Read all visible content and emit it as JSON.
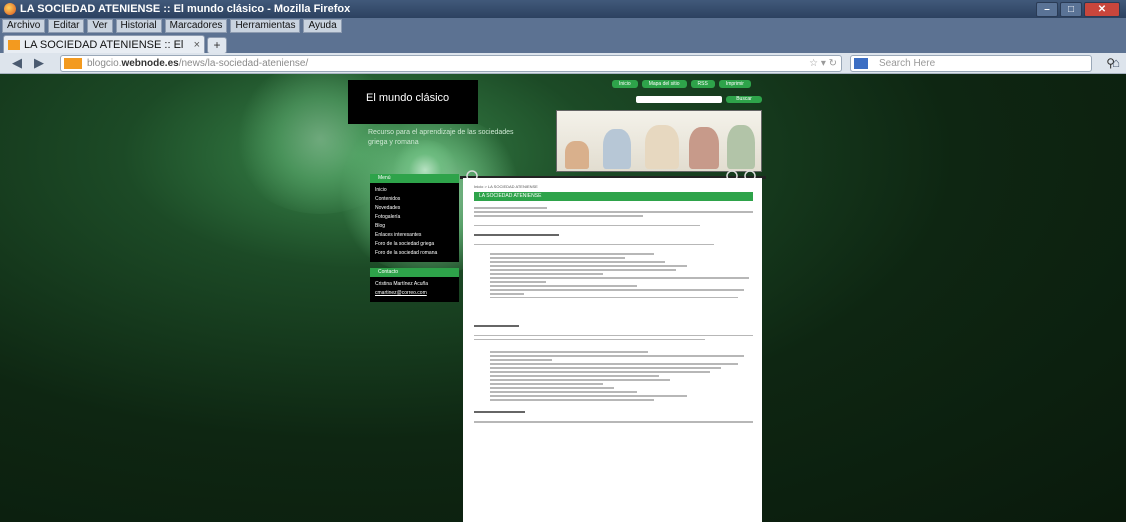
{
  "browser": {
    "window_title": "LA SOCIEDAD ATENIENSE :: El mundo clásico - Mozilla Firefox",
    "menu": [
      "Archivo",
      "Editar",
      "Ver",
      "Historial",
      "Marcadores",
      "Herramientas",
      "Ayuda"
    ],
    "tab_label": "LA SOCIEDAD ATENIENSE :: El mundo cl...",
    "new_tab": "+",
    "url_prefix": "blogcio.",
    "url_domain": "webnode.es",
    "url_path": "/news/la-sociedad-ateniense/",
    "search_placeholder": "Search Here",
    "icons": [
      "back-icon",
      "forward-icon",
      "reload-icon",
      "bookmark-star-icon",
      "search-icon",
      "home-icon"
    ]
  },
  "site": {
    "title": "El mundo clásico",
    "tagline": "Recurso para el aprendizaje de las sociedades griega y romana",
    "nav": [
      "Inicio",
      "Mapa del sitio",
      "RSS",
      "Imprimir"
    ],
    "search_button": "Buscar"
  },
  "sidebar": {
    "menu_title": "Menú",
    "menu_items": [
      "Inicio",
      "Contenidos",
      "Novedades",
      "Fotogalería",
      "Blog",
      "Enlaces interesantes",
      "Foro de la sociedad griega",
      "Foro de la sociedad romana"
    ],
    "contact_title": "Contacto",
    "contact_name": "Cristina Martínez Acuña",
    "contact_email": "cmartinez@correo.com"
  },
  "content": {
    "breadcrumb": "Inicio > LA SOCIEDAD ATENIENSE",
    "title": "LA SOCIEDAD ATENIENSE"
  },
  "colors": {
    "accent": "#2ea34a",
    "page_bg": "#0e2612"
  }
}
